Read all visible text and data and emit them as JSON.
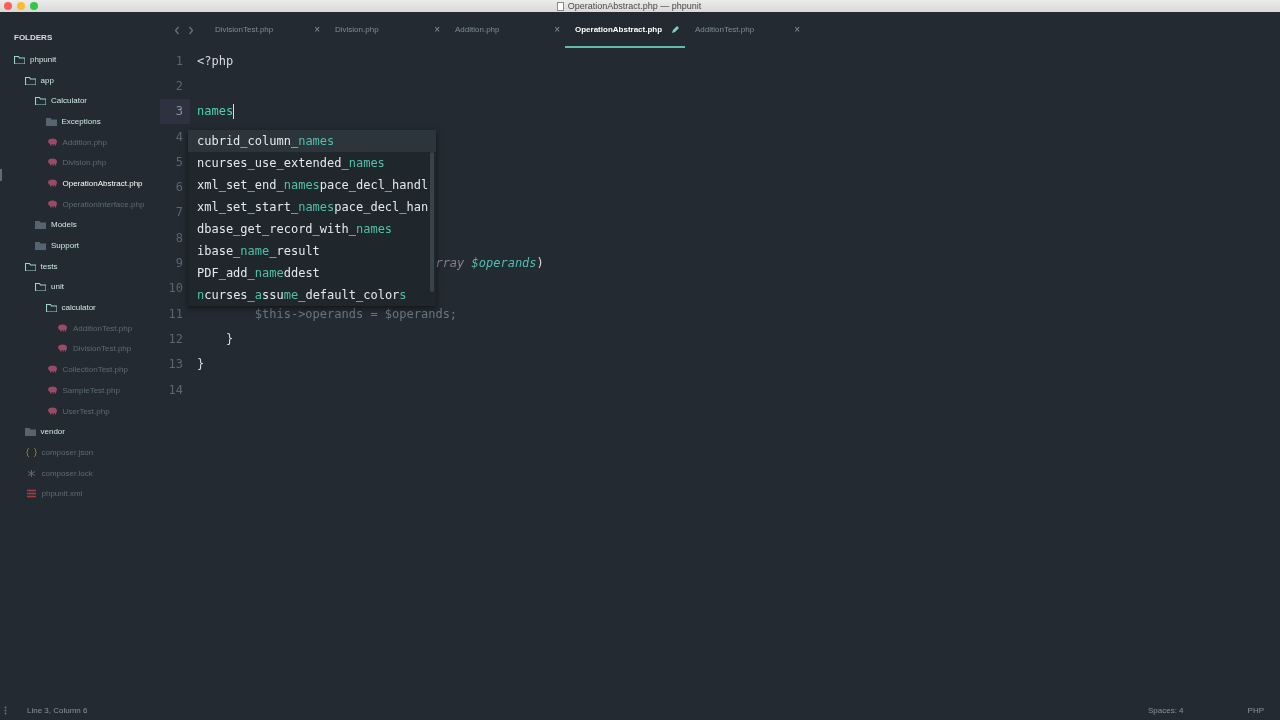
{
  "window": {
    "title": "OperationAbstract.php — phpunit"
  },
  "sidebar": {
    "header": "FOLDERS",
    "tree": [
      {
        "label": "phpunit",
        "kind": "folder",
        "expanded": true,
        "selected": false,
        "children": [
          {
            "label": "app",
            "kind": "folder",
            "expanded": true,
            "selected": false,
            "children": [
              {
                "label": "Calculator",
                "kind": "folder",
                "expanded": true,
                "selected": false,
                "children": [
                  {
                    "label": "Exceptions",
                    "kind": "folder",
                    "expanded": false,
                    "selected": false
                  },
                  {
                    "label": "Addition.php",
                    "kind": "php",
                    "selected": false
                  },
                  {
                    "label": "Division.php",
                    "kind": "php",
                    "selected": false
                  },
                  {
                    "label": "OperationAbstract.php",
                    "kind": "php",
                    "selected": true
                  },
                  {
                    "label": "OperationInterface.php",
                    "kind": "php",
                    "selected": false
                  }
                ]
              },
              {
                "label": "Models",
                "kind": "folder",
                "expanded": false,
                "selected": false
              },
              {
                "label": "Support",
                "kind": "folder",
                "expanded": false,
                "selected": false
              }
            ]
          },
          {
            "label": "tests",
            "kind": "folder",
            "expanded": true,
            "selected": false,
            "children": [
              {
                "label": "unit",
                "kind": "folder",
                "expanded": true,
                "selected": false,
                "children": [
                  {
                    "label": "calculator",
                    "kind": "folder",
                    "expanded": true,
                    "selected": false,
                    "children": [
                      {
                        "label": "AdditionTest.php",
                        "kind": "php",
                        "selected": false
                      },
                      {
                        "label": "DivisionTest.php",
                        "kind": "php",
                        "selected": false
                      }
                    ]
                  },
                  {
                    "label": "CollectionTest.php",
                    "kind": "php",
                    "selected": false
                  },
                  {
                    "label": "SampleTest.php",
                    "kind": "php",
                    "selected": false
                  },
                  {
                    "label": "UserTest.php",
                    "kind": "php",
                    "selected": false
                  }
                ]
              }
            ]
          },
          {
            "label": "vendor",
            "kind": "folder",
            "expanded": false,
            "selected": false
          },
          {
            "label": "composer.json",
            "kind": "json",
            "selected": false
          },
          {
            "label": "composer.lock",
            "kind": "lock",
            "selected": false
          },
          {
            "label": "phpunit.xml",
            "kind": "xml",
            "selected": false
          }
        ]
      }
    ]
  },
  "tabs": [
    {
      "label": "DivisionTest.php",
      "selected": false,
      "modified": false,
      "close": "×"
    },
    {
      "label": "Division.php",
      "selected": false,
      "modified": false,
      "close": "×"
    },
    {
      "label": "Addition.php",
      "selected": false,
      "modified": false,
      "close": "×"
    },
    {
      "label": "OperationAbstract.php",
      "selected": true,
      "modified": true
    },
    {
      "label": "AdditionTest.php",
      "selected": false,
      "modified": false,
      "close": "×"
    }
  ],
  "editor": {
    "lines": [
      {
        "number": "1",
        "current": false,
        "kind": "code",
        "tokens": [
          {
            "t": "<?php",
            "kind": "plain"
          }
        ]
      },
      {
        "number": "2",
        "current": false,
        "kind": "code"
      },
      {
        "number": "3",
        "current": true,
        "kind": "code",
        "tokens": [
          {
            "t": "names",
            "kind": "typed"
          }
        ]
      },
      {
        "number": "4",
        "current": false,
        "kind": "code"
      },
      {
        "number": "5",
        "current": false,
        "kind": "code"
      },
      {
        "number": "6",
        "current": false,
        "kind": "code"
      },
      {
        "number": "7",
        "current": false,
        "kind": "code"
      },
      {
        "number": "8",
        "current": false,
        "kind": "code"
      },
      {
        "number": "9",
        "current": false,
        "kind": "partial",
        "tokens": [
          {
            "t": "rray",
            "kind": "type"
          },
          {
            "t": "$operands",
            "kind": "param"
          },
          {
            "t": ")",
            "kind": "plain"
          }
        ]
      },
      {
        "number": "10",
        "current": false,
        "kind": "code"
      },
      {
        "number": "11",
        "current": false,
        "kind": "indent2",
        "tokens": [
          {
            "t": "$this->operands = $operands;",
            "kind": "dim"
          }
        ]
      },
      {
        "number": "12",
        "current": false,
        "kind": "indent1",
        "tokens": [
          {
            "t": "}",
            "kind": "plain"
          }
        ]
      },
      {
        "number": "13",
        "current": false,
        "kind": "code",
        "tokens": [
          {
            "t": "}",
            "kind": "plain"
          }
        ]
      },
      {
        "number": "14",
        "current": false,
        "kind": "code"
      }
    ],
    "completions": [
      {
        "parts": [
          "cubrid_column_",
          "names"
        ],
        "selected": true
      },
      {
        "parts": [
          "ncurses_use_extended_",
          "names"
        ],
        "selected": false
      },
      {
        "parts": [
          "xml_set_end_",
          "names",
          "pace_decl_handl"
        ],
        "selected": false
      },
      {
        "parts": [
          "xml_set_start_",
          "names",
          "pace_decl_han"
        ],
        "selected": false
      },
      {
        "parts": [
          "dbase_get_record_with_",
          "names"
        ],
        "selected": false
      },
      {
        "parts": [
          "ibase_",
          "name",
          "_result"
        ],
        "selected": false
      },
      {
        "parts": [
          "PDF_add_",
          "name",
          "ddest"
        ],
        "selected": false
      },
      {
        "parts": [
          "n",
          "curses_",
          "a",
          "ssu",
          "me",
          "_default_color",
          "s"
        ],
        "match_first": true,
        "selected": false
      }
    ]
  },
  "status_bar": {
    "position": "Line 3, Column 6",
    "indentation": "Spaces: 4",
    "syntax": "PHP"
  }
}
